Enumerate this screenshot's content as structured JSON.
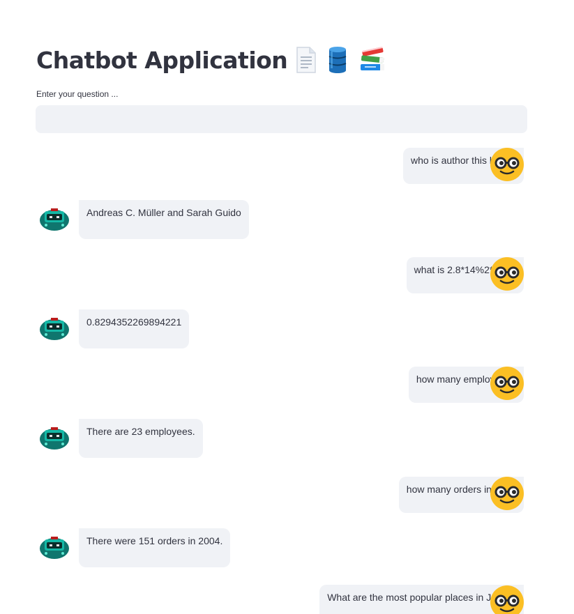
{
  "header": {
    "title": "Chatbot Application",
    "icons": [
      "page-document-icon",
      "database-icon",
      "books-icon"
    ]
  },
  "question_input": {
    "label": "Enter your question ...",
    "value": "",
    "placeholder": ""
  },
  "messages": [
    {
      "role": "user",
      "avatar": "nerd-face-icon",
      "text": "who is author this book?"
    },
    {
      "role": "assistant",
      "avatar": "robot-icon",
      "text": "Andreas C. Müller and Sarah Guido"
    },
    {
      "role": "user",
      "avatar": "nerd-face-icon",
      "text": "what is 2.8*14%2**1.94"
    },
    {
      "role": "assistant",
      "avatar": "robot-icon",
      "text": "0.8294352269894221"
    },
    {
      "role": "user",
      "avatar": "nerd-face-icon",
      "text": "how many employees?"
    },
    {
      "role": "assistant",
      "avatar": "robot-icon",
      "text": "There are 23 employees."
    },
    {
      "role": "user",
      "avatar": "nerd-face-icon",
      "text": "how many orders in 2004"
    },
    {
      "role": "assistant",
      "avatar": "robot-icon",
      "text": "There were 151 orders in 2004."
    },
    {
      "role": "user",
      "avatar": "nerd-face-icon",
      "text": "What are the most popular places in Jordan"
    }
  ],
  "colors": {
    "bubble_bg": "#f0f2f6",
    "text": "#31333f",
    "user_avatar": "#fbbf24",
    "bot_avatar": "#0f766e"
  }
}
